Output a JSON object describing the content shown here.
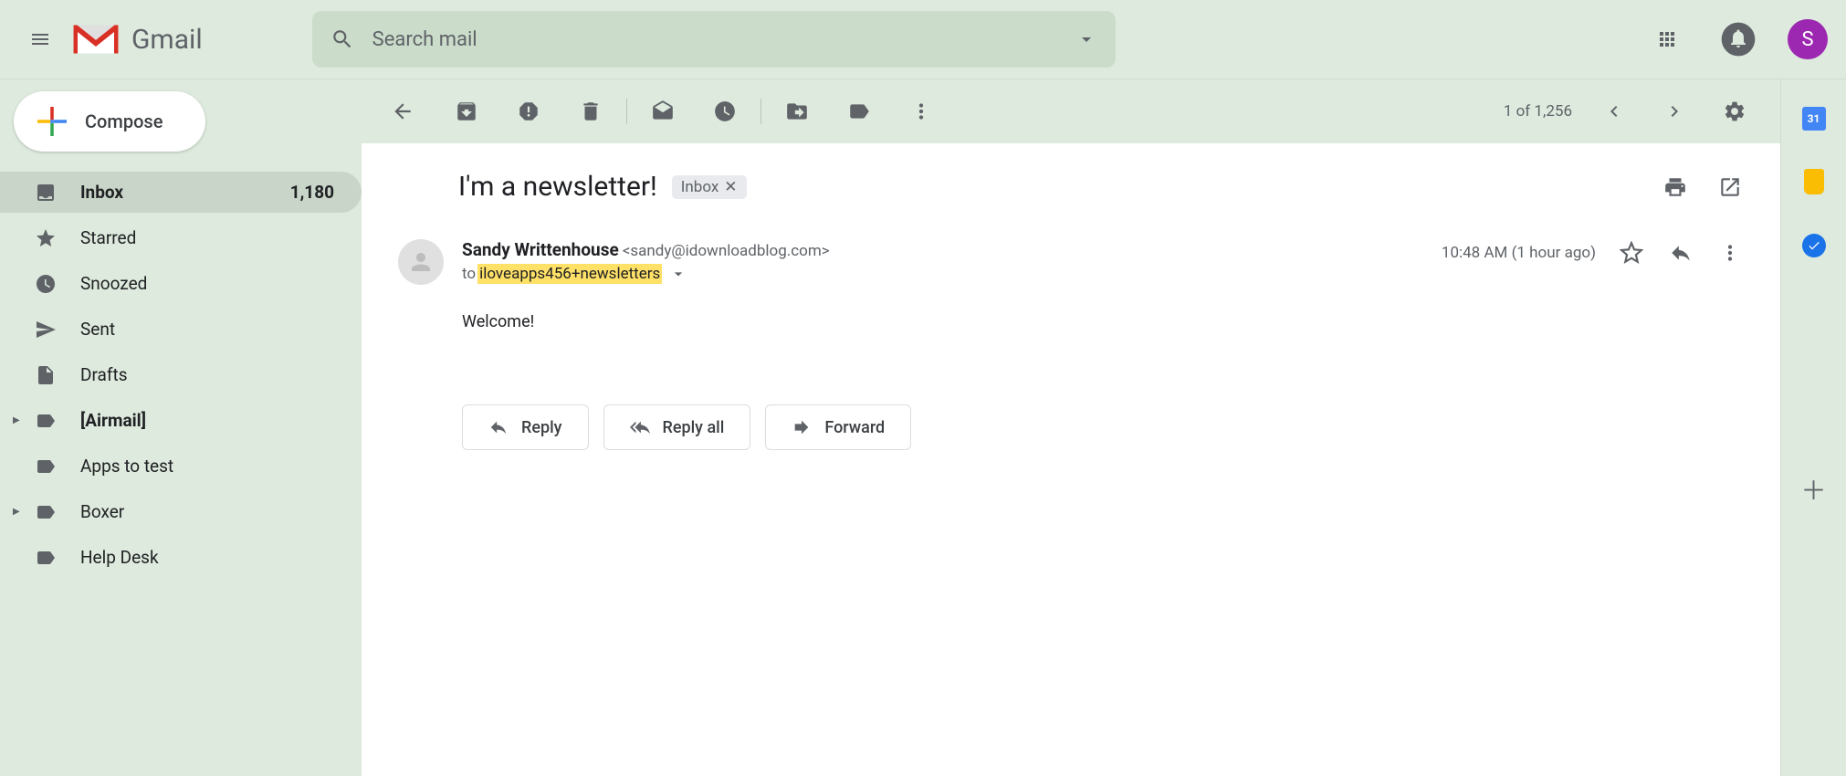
{
  "header": {
    "appName": "Gmail",
    "searchPlaceholder": "Search mail",
    "avatarLetter": "S"
  },
  "sidebar": {
    "composeLabel": "Compose",
    "items": [
      {
        "label": "Inbox",
        "count": "1,180",
        "active": true,
        "bold": true,
        "icon": "inbox"
      },
      {
        "label": "Starred",
        "icon": "star"
      },
      {
        "label": "Snoozed",
        "icon": "clock"
      },
      {
        "label": "Sent",
        "icon": "send"
      },
      {
        "label": "Drafts",
        "icon": "file"
      },
      {
        "label": "[Airmail]",
        "bold": true,
        "icon": "tag",
        "expandable": true
      },
      {
        "label": "Apps to test",
        "icon": "tag"
      },
      {
        "label": "Boxer",
        "icon": "tag",
        "expandable": true
      },
      {
        "label": "Help Desk",
        "icon": "tag"
      }
    ]
  },
  "toolbar": {
    "counter": "1 of 1,256"
  },
  "email": {
    "subject": "I'm a newsletter!",
    "labelChip": "Inbox",
    "senderName": "Sandy Writtenhouse",
    "senderEmail": "<sandy@idownloadblog.com>",
    "recipientPrefix": "to ",
    "recipientHighlight": "iloveapps456+newsletters",
    "time": "10:48 AM (1 hour ago)",
    "body": "Welcome!",
    "replyLabel": "Reply",
    "replyAllLabel": "Reply all",
    "forwardLabel": "Forward"
  },
  "rightSidebar": {
    "calendarDay": "31"
  }
}
